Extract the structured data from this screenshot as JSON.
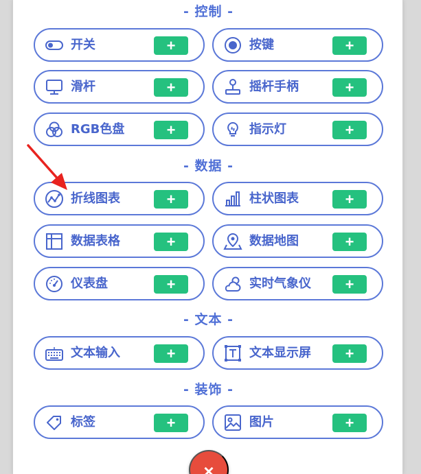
{
  "sections": {
    "control": "- 控制 -",
    "data": "- 数据 -",
    "text": "- 文本 -",
    "decor": "- 装饰 -"
  },
  "add_label": "+",
  "close_label": "×",
  "widgets": {
    "switch": "开关",
    "button": "按键",
    "slider": "滑杆",
    "joystick": "摇杆手柄",
    "rgb": "RGB色盘",
    "indicator": "指示灯",
    "line_chart": "折线图表",
    "bar_chart": "柱状图表",
    "table": "数据表格",
    "map": "数据地图",
    "gauge": "仪表盘",
    "weather": "实时气象仪",
    "text_input": "文本输入",
    "text_display": "文本显示屏",
    "tag": "标签",
    "image": "图片"
  },
  "colors": {
    "accent": "#5b78d8",
    "add_button": "#25c17f",
    "close_button": "#e74c3c",
    "annotation_arrow": "#e8231f"
  }
}
